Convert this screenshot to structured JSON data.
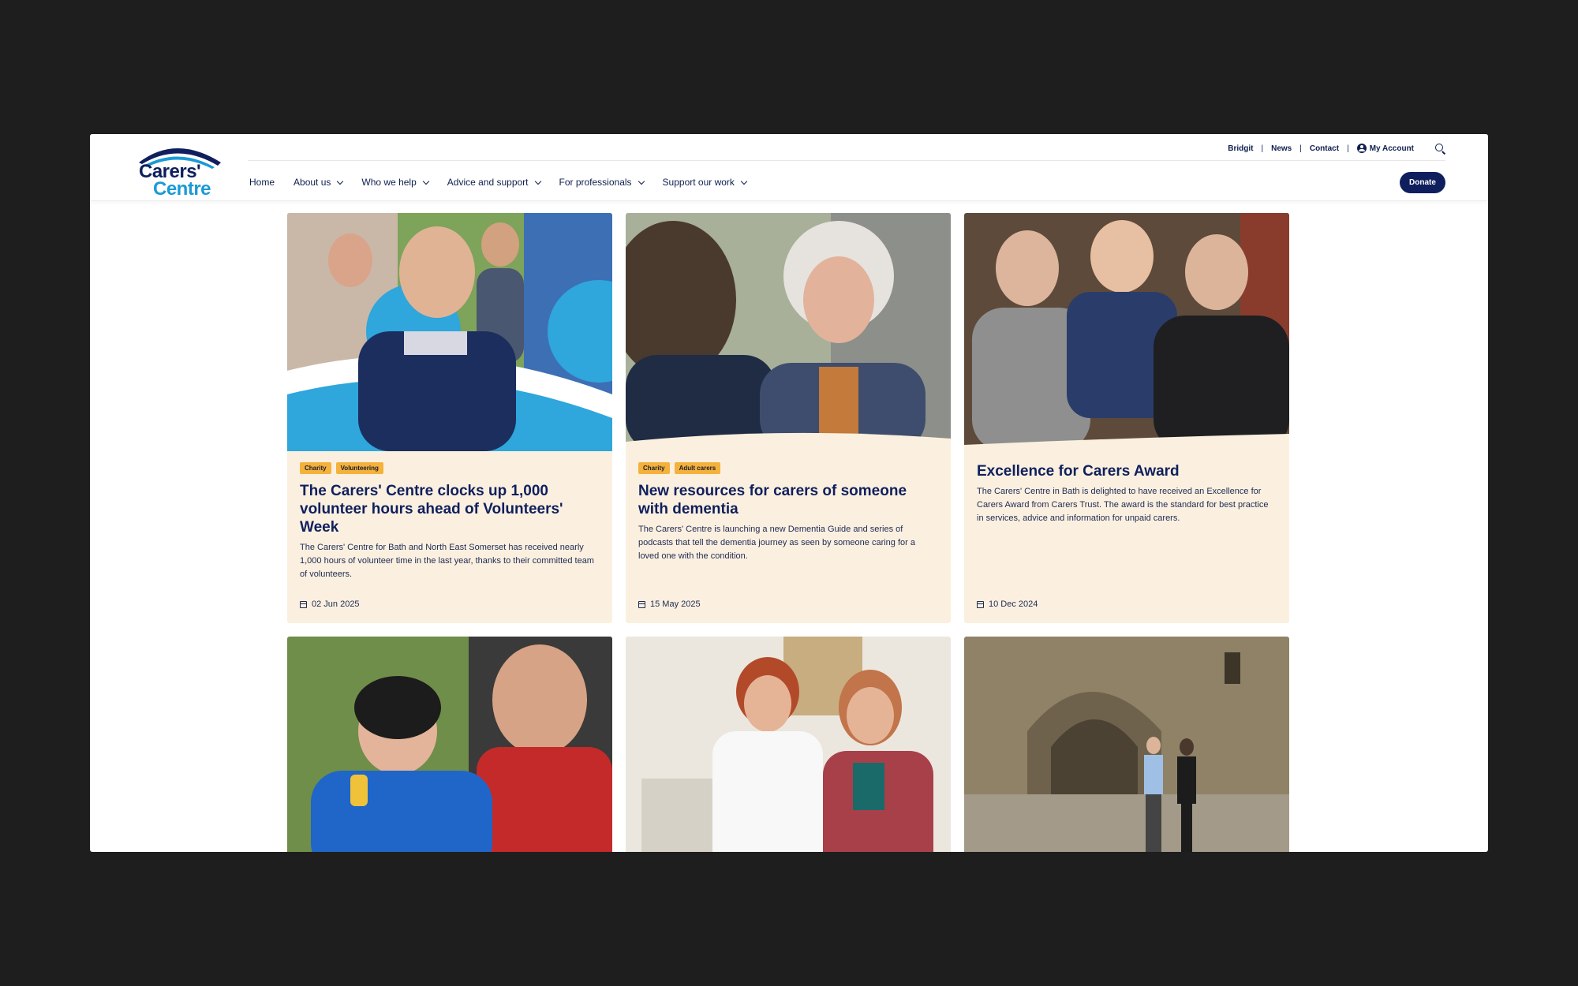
{
  "logo": {
    "line1": "Carers'",
    "line2": "Centre"
  },
  "utility_nav": {
    "links": [
      "Bridgit",
      "News",
      "Contact"
    ],
    "account": "My Account",
    "separator": "|"
  },
  "main_nav": {
    "items": [
      {
        "label": "Home",
        "dropdown": false
      },
      {
        "label": "About us",
        "dropdown": true
      },
      {
        "label": "Who we help",
        "dropdown": true
      },
      {
        "label": "Advice and support",
        "dropdown": true
      },
      {
        "label": "For professionals",
        "dropdown": true
      },
      {
        "label": "Support our work",
        "dropdown": true
      }
    ]
  },
  "donate_label": "Donate",
  "cards": [
    {
      "tags": [
        "Charity",
        "Volunteering"
      ],
      "title": "The Carers' Centre clocks up 1,000 volunteer hours ahead of Volunteers' Week",
      "excerpt": "The Carers' Centre for Bath and North East Somerset has received nearly 1,000 hours of volunteer time in the last year, thanks to their committed team of volunteers.",
      "date": "02 Jun 2025"
    },
    {
      "tags": [
        "Charity",
        "Adult carers"
      ],
      "title": "New resources for carers of someone with dementia",
      "excerpt": "The Carers' Centre is launching a new Dementia Guide and series of podcasts that tell the dementia journey as seen by someone caring for a loved one with the condition.",
      "date": "15 May 2025"
    },
    {
      "tags": [],
      "title": "Excellence for Carers Award",
      "excerpt": "The Carers' Centre in Bath is delighted to have received an Excellence for Carers Award from Carers Trust. The award is the standard for best practice in services, advice and information for unpaid carers.",
      "date": "10 Dec 2024"
    }
  ],
  "colors": {
    "brand_navy": "#0f1f5e",
    "brand_blue": "#1b9ad6",
    "card_bg": "#fbf0df",
    "tag_bg": "#f4b23c"
  }
}
